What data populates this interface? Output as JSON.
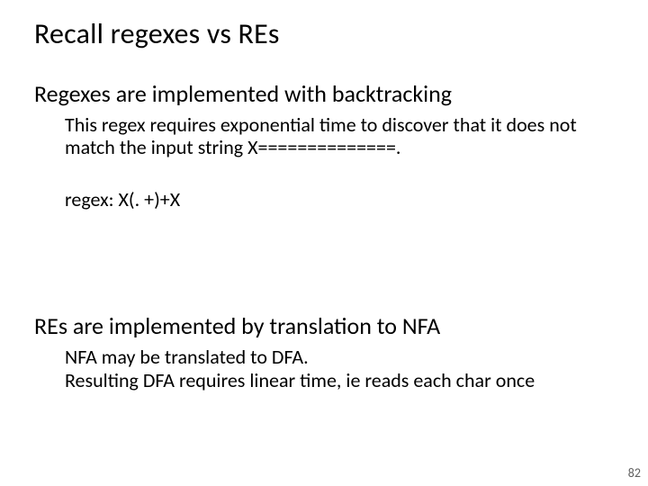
{
  "title": "Recall regexes vs REs",
  "section1": {
    "heading": "Regexes are implemented with backtracking",
    "body": "This regex requires exponential time to discover that it does not match the input string X==============.",
    "regex": "regex: X(. +)+X"
  },
  "section2": {
    "heading": "REs are implemented by translation to NFA",
    "line1": "NFA may be translated to DFA.",
    "line2": "Resulting DFA requires linear time, ie reads each char once"
  },
  "page_number": "82"
}
